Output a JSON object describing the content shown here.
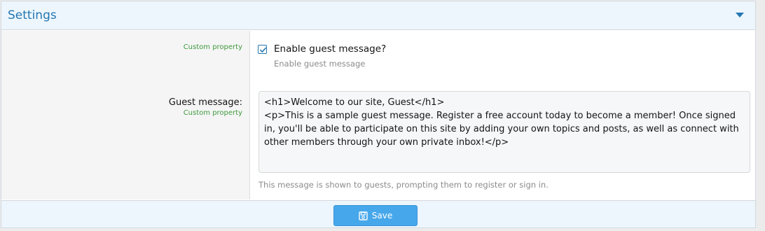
{
  "header": {
    "title": "Settings",
    "collapse_icon": "caret-down-icon"
  },
  "fields": {
    "enable_guest": {
      "hint": "Custom property",
      "checked": true,
      "label": "Enable guest message?",
      "explain": "Enable guest message"
    },
    "guest_message": {
      "label": "Guest message:",
      "hint": "Custom property",
      "value": "<h1>Welcome to our site, Guest</h1>\n<p>This is a sample guest message. Register a free account today to become a member! Once signed in, you'll be able to participate on this site by adding your own topics and posts, as well as connect with other members through your own private inbox!</p>",
      "explain": "This message is shown to guests, prompting them to register or sign in."
    }
  },
  "footer": {
    "save_label": "Save",
    "save_icon": "floppy-disk-icon"
  },
  "colors": {
    "accent": "#2577b1",
    "button": "#47a7eb",
    "hint_green": "#3f9a3f",
    "header_bg": "#edf6fd"
  }
}
